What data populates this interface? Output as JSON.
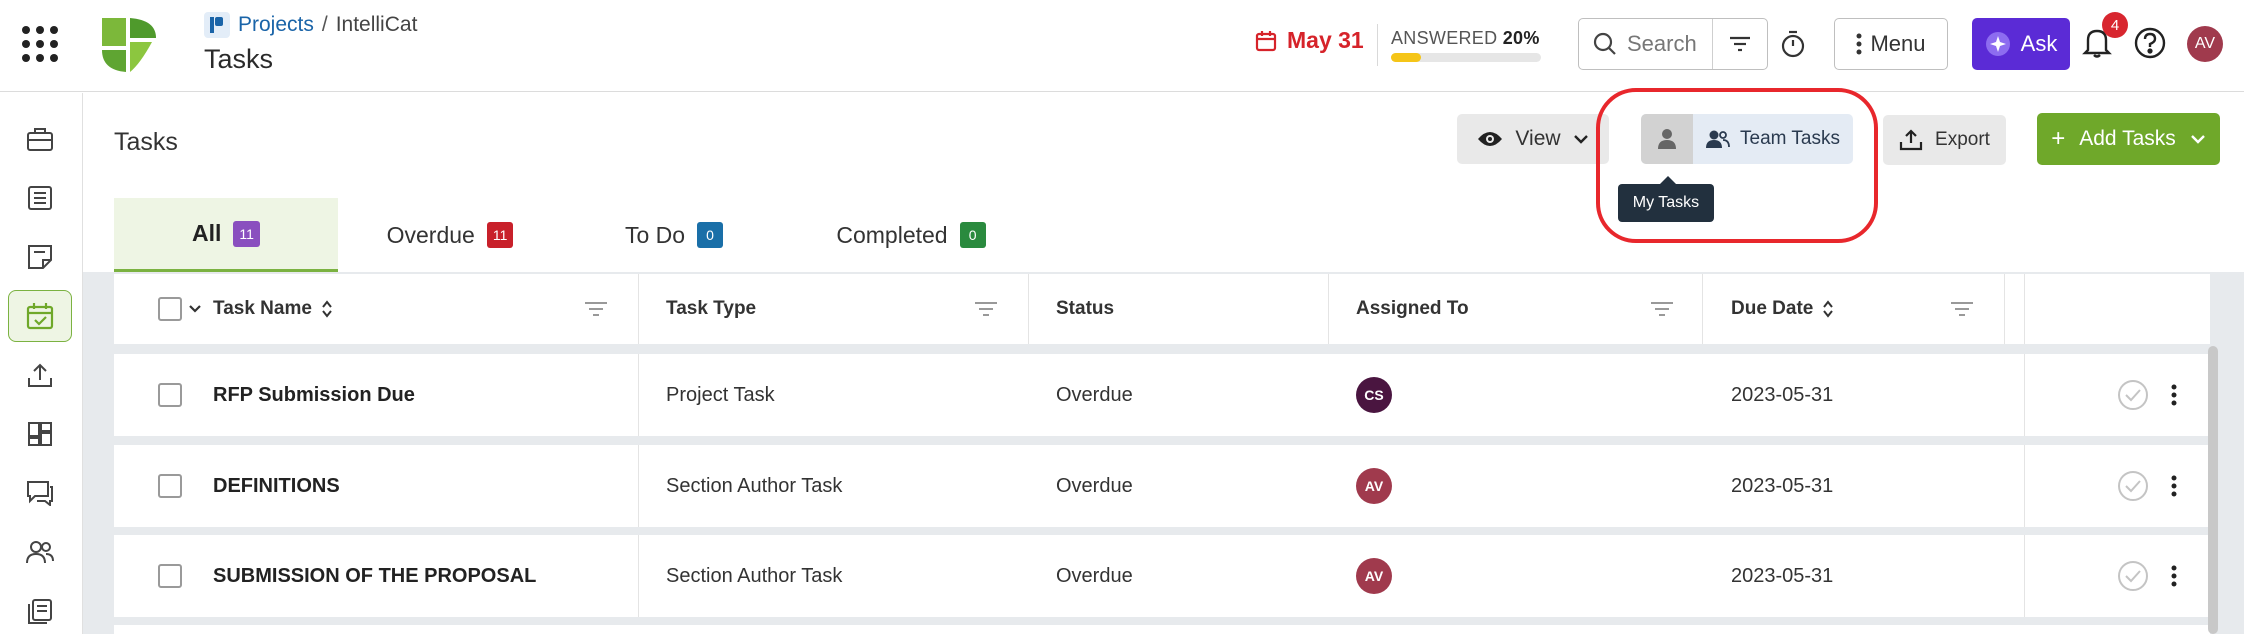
{
  "header": {
    "breadcrumb_projects": "Projects",
    "breadcrumb_sep": "/",
    "breadcrumb_current": "IntelliCat",
    "page_title": "Tasks",
    "due_date": "May 31",
    "answered_label": "ANSWERED",
    "answered_pct": "20%",
    "answered_fraction": 0.2,
    "search_placeholder": "Search",
    "menu_label": "Menu",
    "ask_label": "Ask",
    "notification_count": "4",
    "user_initials": "AV"
  },
  "main": {
    "title": "Tasks",
    "view_label": "View",
    "my_tasks_tooltip": "My Tasks",
    "team_tasks_label": "Team Tasks",
    "export_label": "Export",
    "add_tasks_label": "Add Tasks"
  },
  "tabs": [
    {
      "label": "All",
      "count": "11",
      "color": "#8a4fbf"
    },
    {
      "label": "Overdue",
      "count": "11",
      "color": "#c8202a"
    },
    {
      "label": "To Do",
      "count": "0",
      "color": "#1a6fa8"
    },
    {
      "label": "Completed",
      "count": "0",
      "color": "#2a8a3e"
    }
  ],
  "table": {
    "columns": [
      "Task Name",
      "Task Type",
      "Status",
      "Assigned To",
      "Due Date"
    ],
    "rows": [
      {
        "name": "RFP Submission Due",
        "type": "Project Task",
        "status": "Overdue",
        "assignee": "CS",
        "assignee_color": "#4a1540",
        "due": "2023-05-31"
      },
      {
        "name": "DEFINITIONS",
        "type": "Section Author Task",
        "status": "Overdue",
        "assignee": "AV",
        "assignee_color": "#a03a4d",
        "due": "2023-05-31"
      },
      {
        "name": "SUBMISSION OF THE PROPOSAL",
        "type": "Section Author Task",
        "status": "Overdue",
        "assignee": "AV",
        "assignee_color": "#a03a4d",
        "due": "2023-05-31"
      }
    ]
  },
  "colors": {
    "accent_green": "#6fa82a",
    "ask_purple": "#5b2bd6",
    "date_red": "#d6232a",
    "highlight_red": "#e8272c"
  }
}
